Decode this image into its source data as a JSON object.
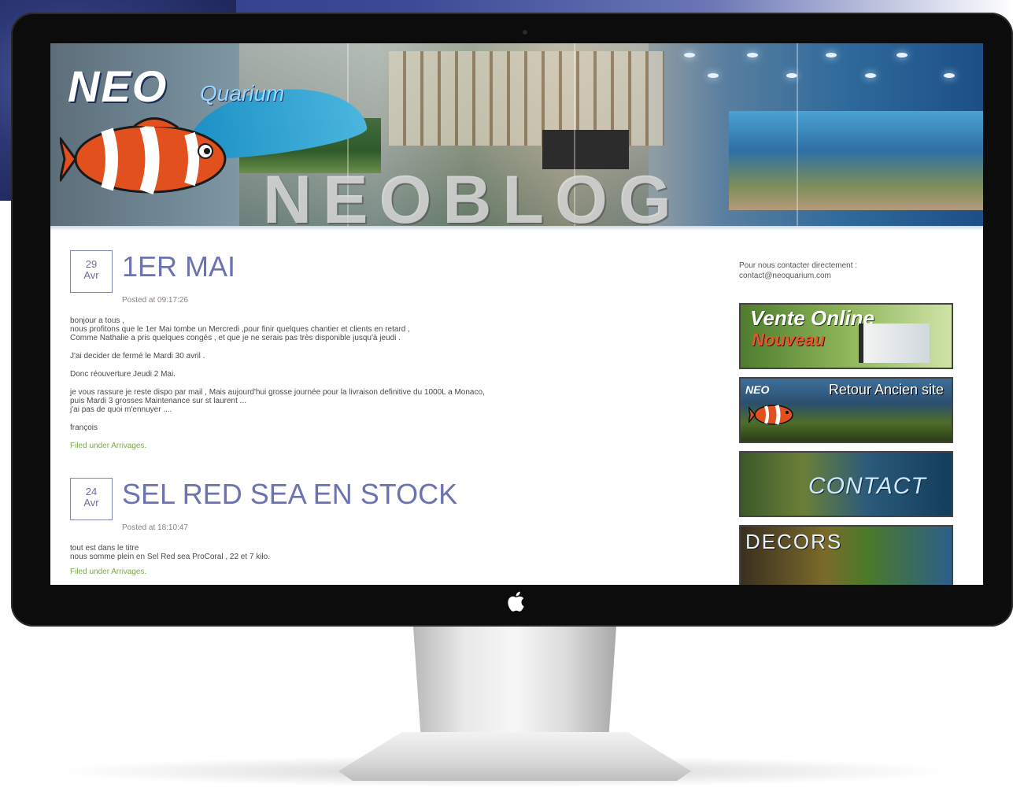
{
  "site": {
    "logo_neo": "NEO",
    "logo_quarium": "Quarium",
    "banner_title": "NEOBLOG"
  },
  "posts": [
    {
      "day": "29",
      "month": "Avr",
      "title": "1ER MAI",
      "meta": "Posted at 09:17:26",
      "paragraphs": [
        "bonjour a tous ,\nnous profitons que le 1er Mai tombe un Mercredi ,pour finir quelques chantier et clients en retard ,\nComme Nathalie a pris quelques congés , et que je ne serais pas très disponible jusqu'à jeudi .",
        "J'ai decider de fermé le Mardi 30 avril .",
        "Donc réouverture Jeudi 2 Mai.",
        "je vous rassure je reste dispo par mail , Mais aujourd'hui grosse journée pour la livraison definitive du 1000L a Monaco,\npuis Mardi 3 grosses Maintenance sur st laurent ...\nj'ai pas de quoi m'ennuyer ....",
        "françois"
      ],
      "filed": "Filed under Arrivages."
    },
    {
      "day": "24",
      "month": "Avr",
      "title": "SEL RED SEA EN STOCK",
      "meta": "Posted at 18:10:47",
      "paragraphs": [
        "tout est dans le titre\nnous somme plein en Sel Red sea ProCoral , 22 et 7 kilo."
      ],
      "filed": "Filed under Arrivages."
    }
  ],
  "sidebar": {
    "contact_line1": "Pour nous contacter directement :",
    "contact_line2": "contact@neoquarium.com",
    "banners": {
      "vente_line1": "Vente Online",
      "vente_line2": "Nouveau",
      "retour_neo": "NEO",
      "retour": "Retour Ancien site",
      "contact": "CONTACT",
      "decors": "DECORS"
    }
  },
  "colors": {
    "title_accent": "#6b74b0",
    "filed_link": "#7fa74e",
    "bezel": "#0c0c0c"
  }
}
